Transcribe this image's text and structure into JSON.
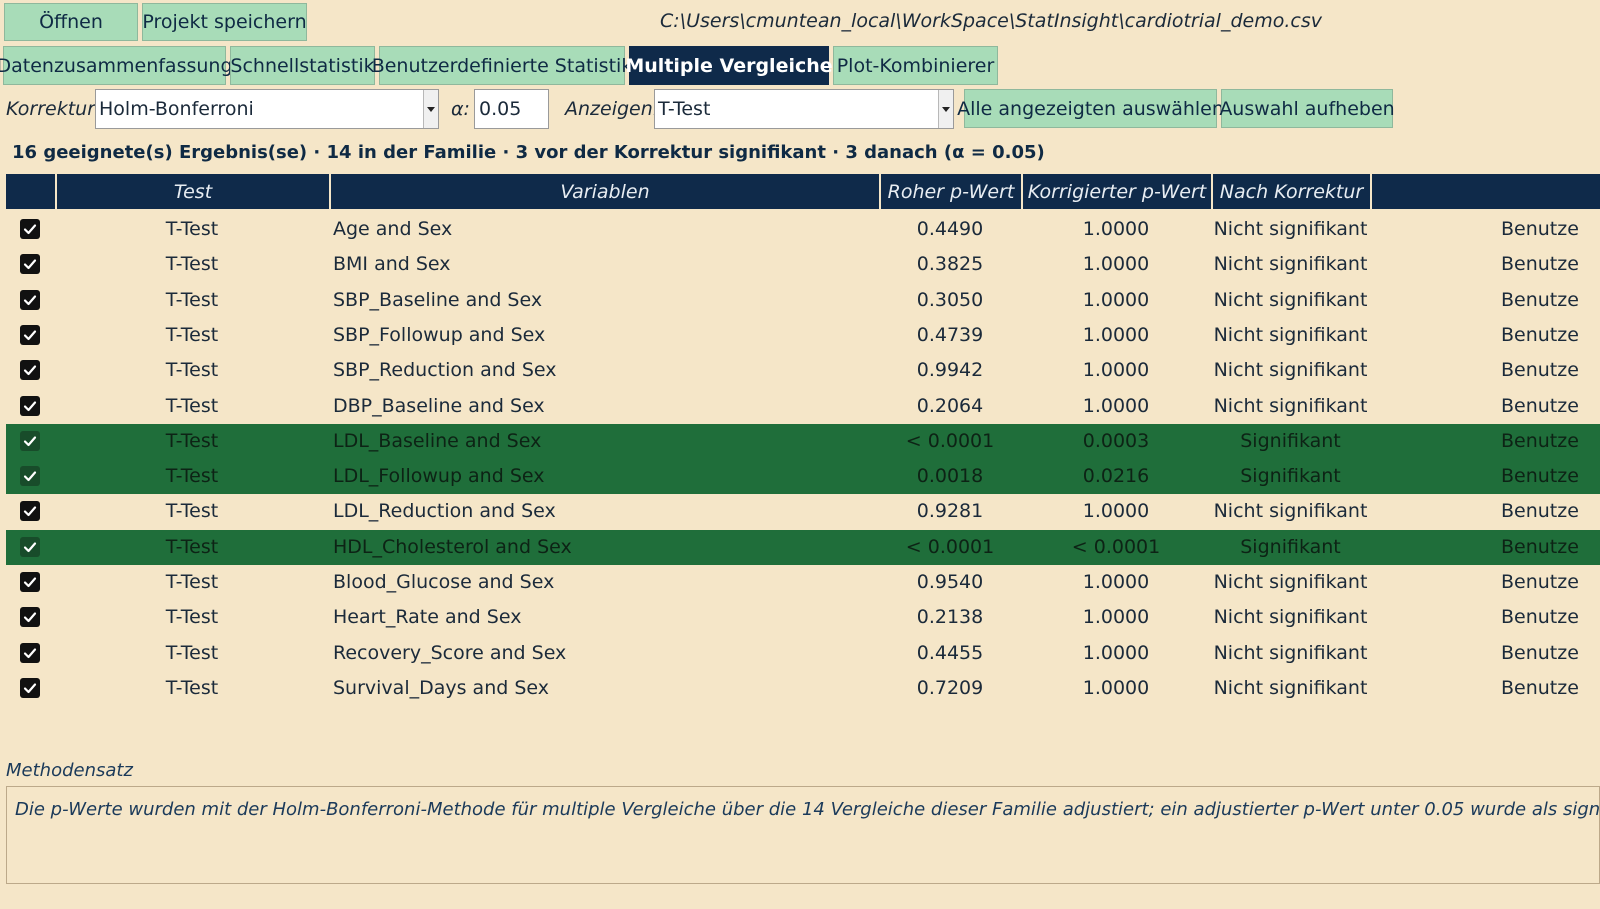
{
  "toolbar": {
    "open_label": "Öffnen",
    "save_label": "Projekt speichern"
  },
  "file_path": "C:\\Users\\cmuntean_local\\WorkSpace\\StatInsight\\cardiotrial_demo.csv",
  "tabs": [
    {
      "label": "Datenzusammenfassung"
    },
    {
      "label": "Schnellstatistik"
    },
    {
      "label": "Benutzerdefinierte Statistik"
    },
    {
      "label": "Multiple Vergleiche",
      "active": true
    },
    {
      "label": "Plot-Kombinierer"
    }
  ],
  "controls": {
    "correction_label": "Korrektur:",
    "correction_value": "Holm-Bonferroni",
    "alpha_label": "α:",
    "alpha_value": "0.05",
    "show_label": "Anzeigen:",
    "show_value": "T-Test",
    "select_all_label": "Alle angezeigten auswählen",
    "clear_label": "Auswahl aufheben"
  },
  "summary": "16 geeignete(s) Ergebnis(se) · 14 in der Familie · 3 vor der Korrektur signifikant · 3 danach (α = 0.05)",
  "table": {
    "headers": [
      "Test",
      "Variablen",
      "Roher p-Wert",
      "Korrigierter p-Wert",
      "Nach Korrektur"
    ],
    "rows": [
      {
        "test": "T-Test",
        "vars": "Age and Sex",
        "raw": "0.4490",
        "adj": "1.0000",
        "status": "Nicht signifikant",
        "source": "Benutze",
        "sig": false
      },
      {
        "test": "T-Test",
        "vars": "BMI and Sex",
        "raw": "0.3825",
        "adj": "1.0000",
        "status": "Nicht signifikant",
        "source": "Benutze",
        "sig": false
      },
      {
        "test": "T-Test",
        "vars": "SBP_Baseline and Sex",
        "raw": "0.3050",
        "adj": "1.0000",
        "status": "Nicht signifikant",
        "source": "Benutze",
        "sig": false
      },
      {
        "test": "T-Test",
        "vars": "SBP_Followup and Sex",
        "raw": "0.4739",
        "adj": "1.0000",
        "status": "Nicht signifikant",
        "source": "Benutze",
        "sig": false
      },
      {
        "test": "T-Test",
        "vars": "SBP_Reduction and Sex",
        "raw": "0.9942",
        "adj": "1.0000",
        "status": "Nicht signifikant",
        "source": "Benutze",
        "sig": false
      },
      {
        "test": "T-Test",
        "vars": "DBP_Baseline and Sex",
        "raw": "0.2064",
        "adj": "1.0000",
        "status": "Nicht signifikant",
        "source": "Benutze",
        "sig": false
      },
      {
        "test": "T-Test",
        "vars": "LDL_Baseline and Sex",
        "raw": "< 0.0001",
        "adj": "0.0003",
        "status": "Signifikant",
        "source": "Benutze",
        "sig": true
      },
      {
        "test": "T-Test",
        "vars": "LDL_Followup and Sex",
        "raw": "0.0018",
        "adj": "0.0216",
        "status": "Signifikant",
        "source": "Benutze",
        "sig": true
      },
      {
        "test": "T-Test",
        "vars": "LDL_Reduction and Sex",
        "raw": "0.9281",
        "adj": "1.0000",
        "status": "Nicht signifikant",
        "source": "Benutze",
        "sig": false
      },
      {
        "test": "T-Test",
        "vars": "HDL_Cholesterol and Sex",
        "raw": "< 0.0001",
        "adj": "< 0.0001",
        "status": "Signifikant",
        "source": "Benutze",
        "sig": true
      },
      {
        "test": "T-Test",
        "vars": "Blood_Glucose and Sex",
        "raw": "0.9540",
        "adj": "1.0000",
        "status": "Nicht signifikant",
        "source": "Benutze",
        "sig": false
      },
      {
        "test": "T-Test",
        "vars": "Heart_Rate and Sex",
        "raw": "0.2138",
        "adj": "1.0000",
        "status": "Nicht signifikant",
        "source": "Benutze",
        "sig": false
      },
      {
        "test": "T-Test",
        "vars": "Recovery_Score and Sex",
        "raw": "0.4455",
        "adj": "1.0000",
        "status": "Nicht signifikant",
        "source": "Benutze",
        "sig": false
      },
      {
        "test": "T-Test",
        "vars": "Survival_Days and Sex",
        "raw": "0.7209",
        "adj": "1.0000",
        "status": "Nicht signifikant",
        "source": "Benutze",
        "sig": false
      }
    ]
  },
  "method": {
    "label": "Methodensatz",
    "text": "Die p-Werte wurden mit der Holm-Bonferroni-Methode für multiple Vergleiche über die 14 Vergleiche dieser Familie adjustiert; ein adjustierter p-Wert unter 0.05 wurde als signifikant"
  },
  "colors": {
    "background": "#f5e6c8",
    "header": "#0f2a4a",
    "button": "#a8dcb8",
    "significant_row": "#1f6e3a"
  }
}
